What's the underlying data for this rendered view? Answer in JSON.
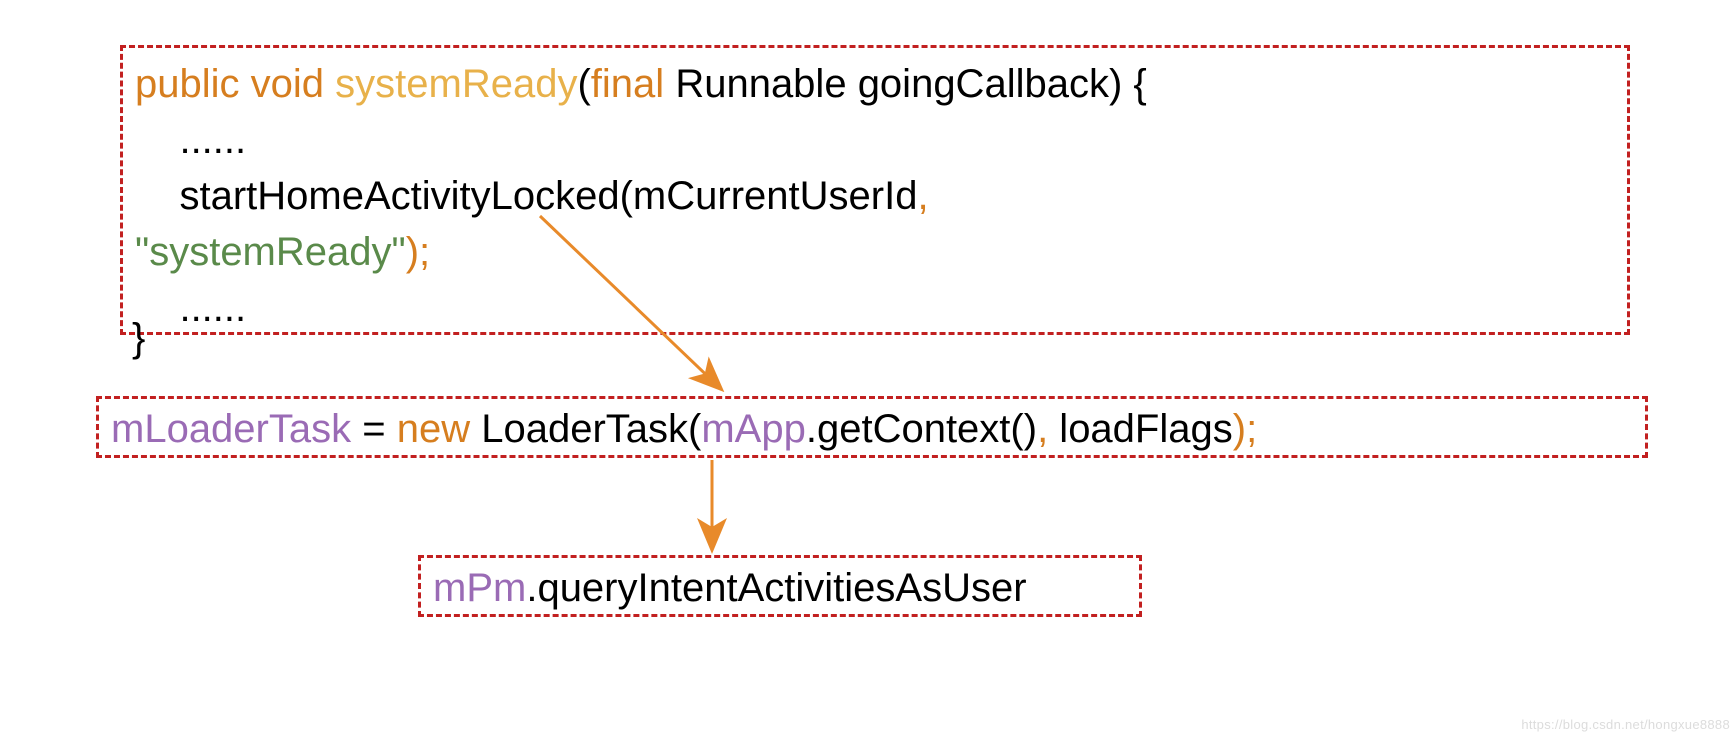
{
  "box1": {
    "kw_public": "public",
    "kw_void": "void",
    "method": "systemReady",
    "paren_open": "(",
    "kw_final": "final",
    "param_type": "Runnable",
    "param_name": "goingCallback",
    "paren_close": ")",
    "brace_open": "{",
    "dots1": "......",
    "call_name": "startHomeActivityLocked(mCurrentUserId",
    "comma1": ",",
    "str_arg": "\"systemReady\"",
    "close_call": ");",
    "dots2": "......",
    "brace_close": "}"
  },
  "box2": {
    "var1": "mLoaderTask",
    "eq": " = ",
    "kw_new": "new",
    "ctor": " LoaderTask(",
    "var2": "mApp",
    "call": ".getContext()",
    "comma": ",",
    "arg2": " loadFlags",
    "close": ");"
  },
  "box3": {
    "var1": "mPm",
    "call": ".queryIntentActivitiesAsUser"
  },
  "watermark": "https://blog.csdn.net/hongxue8888",
  "colors": {
    "border": "#c22020",
    "orange": "#d67e1f",
    "yellow": "#e8b14a",
    "green": "#5a8a4a",
    "purple": "#9a6bb5",
    "arrow": "#e88a2a"
  }
}
